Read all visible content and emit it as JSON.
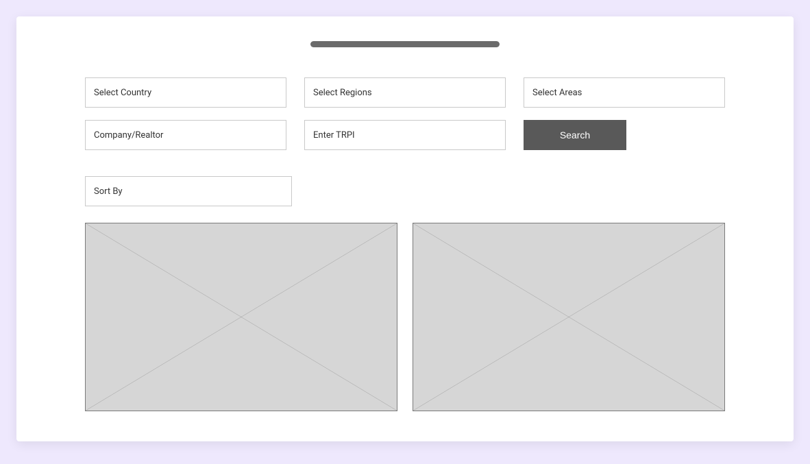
{
  "filters": {
    "country": {
      "placeholder": "Select Country"
    },
    "regions": {
      "placeholder": "Select Regions"
    },
    "areas": {
      "placeholder": "Select Areas"
    },
    "company": {
      "placeholder": "Company/Realtor"
    },
    "trpi": {
      "placeholder": "Enter TRPI"
    },
    "search_label": "Search"
  },
  "sort": {
    "placeholder": "Sort By"
  }
}
